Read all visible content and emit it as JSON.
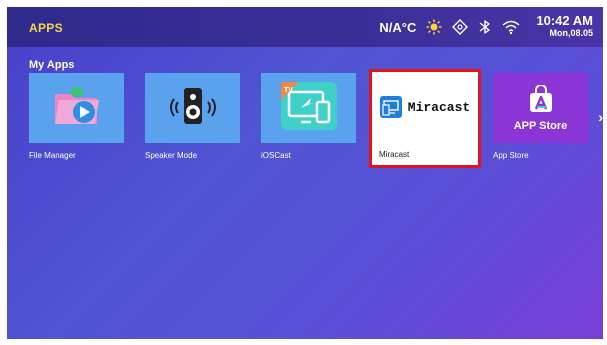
{
  "header": {
    "title": "APPS",
    "temperature": "N/A°C",
    "time": "10:42 AM",
    "date": "Mon,08.05"
  },
  "section": {
    "title": "My Apps"
  },
  "apps": [
    {
      "label": "File Manager",
      "icon": "file-manager-icon",
      "tile_color": "#5aa2ee"
    },
    {
      "label": "Speaker Mode",
      "icon": "speaker-icon",
      "tile_color": "#5aa2ee"
    },
    {
      "label": "iOSCast",
      "icon": "ioscast-icon",
      "tile_color": "#5aa2ee",
      "badge": "TV"
    },
    {
      "label": "Miracast",
      "icon": "miracast-icon",
      "tile_text": "Miracast",
      "selected": true
    },
    {
      "label": "App Store",
      "icon": "app-store-icon",
      "tile_text": "APP Store",
      "tile_color": "#8b35d6"
    }
  ],
  "colors": {
    "title": "#f4d54a",
    "selection_border": "#e2141b"
  }
}
